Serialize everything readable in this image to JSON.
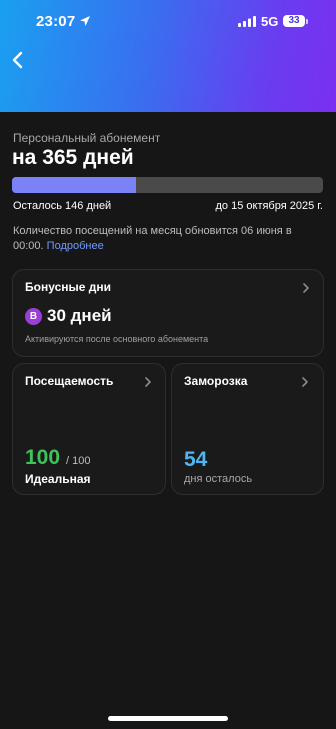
{
  "status_bar": {
    "time": "23:07",
    "network": "5G",
    "battery": "33",
    "icons": [
      "location-arrow-icon",
      "signal-bars-icon",
      "battery-icon"
    ]
  },
  "header": {
    "back_icon": "chevron-left-icon"
  },
  "subscription": {
    "subtitle": "Персональный абонемент",
    "title": "на 365 дней",
    "progress_fraction": 0.4,
    "remaining": "Осталось 146 дней",
    "until": "до 15 октября 2025 г.",
    "notice_text": "Количество посещений на месяц обновится 06 июня в 00:00.",
    "notice_link": "Подробнее"
  },
  "bonus": {
    "title": "Бонусные дни",
    "icon_letter": "B",
    "value": "30 дней",
    "note": "Активируются после основного абонемента"
  },
  "visits": {
    "title": "Посещаемость",
    "value": "100",
    "max": "/ 100",
    "status": "Идеальная"
  },
  "freeze": {
    "title": "Заморозка",
    "value": "54",
    "caption": "дня осталось"
  },
  "colors": {
    "progress_fill": "#7b82f5",
    "visits_value": "#3ec25a",
    "freeze_value": "#4fb6f2",
    "link": "#6f9bff",
    "bonus_icon": "#9a3fd4"
  }
}
